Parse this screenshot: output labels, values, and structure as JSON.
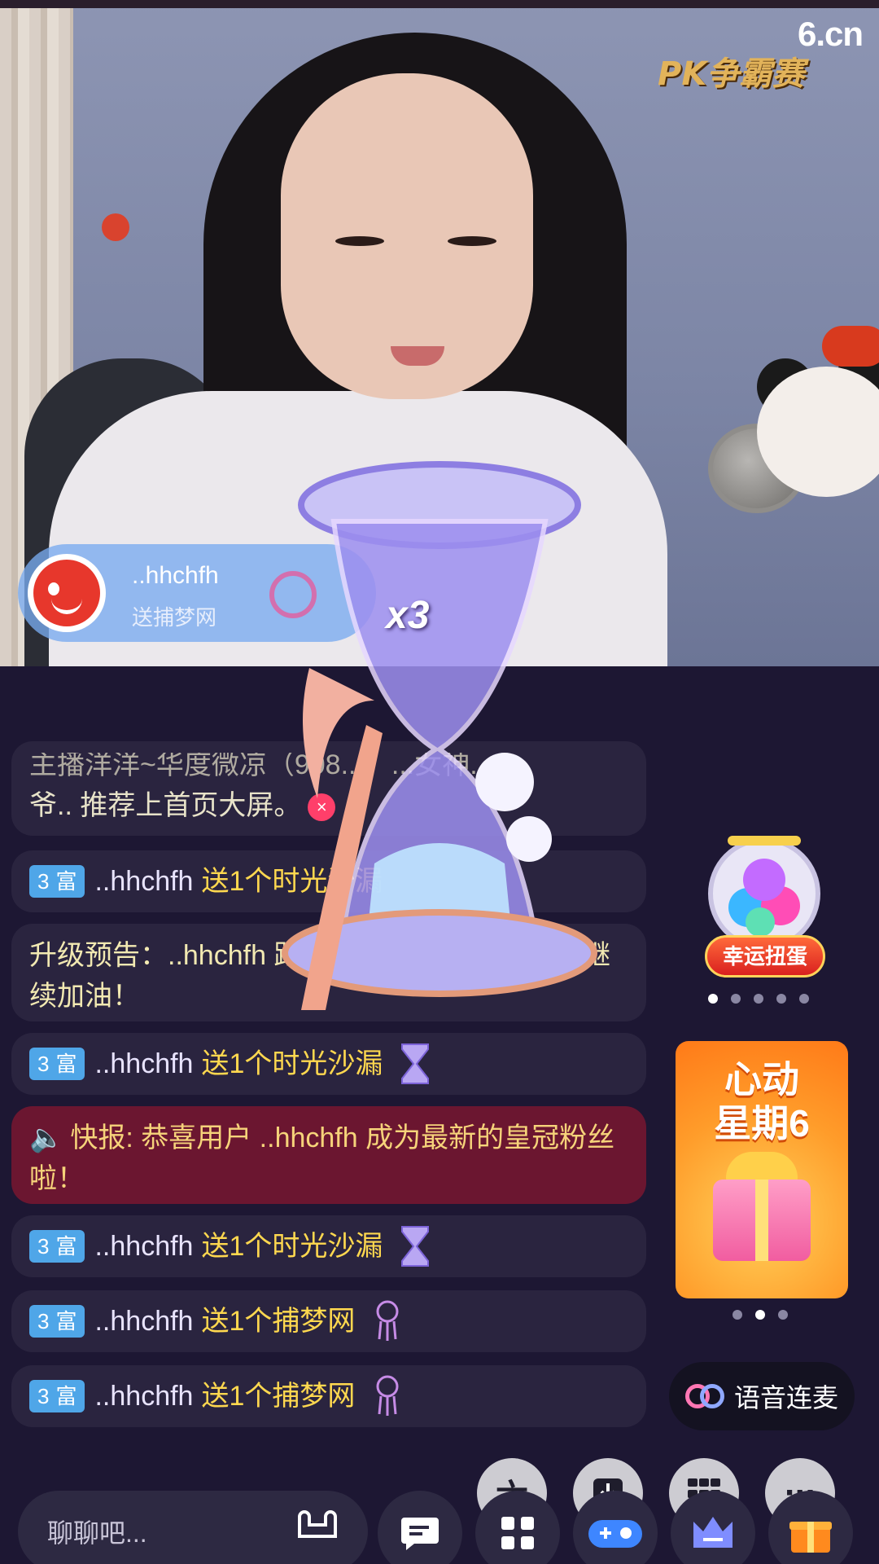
{
  "branding": {
    "site_logo": "6.cn",
    "pk_badge": "PK争霸赛"
  },
  "gift_notice": {
    "user": "..hhchfh",
    "action": "送捕梦网",
    "multiplier": "x3"
  },
  "chat": {
    "partial_top": "主播洋洋~华度微凉（908...）...女神...",
    "recommend_msg": "爷.. 推荐上首页大屏。",
    "messages": [
      {
        "level": "3",
        "level_label": "富",
        "user": "..hhchfh",
        "text": "送1个时光沙漏"
      },
      {
        "upgrade": "升级预告：..hhchfh 距 4 富 还差 ...345六币，继续加油！"
      },
      {
        "level": "3",
        "level_label": "富",
        "user": "..hhchfh",
        "text": "送1个时光沙漏"
      },
      {
        "alert": "快报: 恭喜用户 ..hhchfh 成为最新的皇冠粉丝啦！"
      },
      {
        "level": "3",
        "level_label": "富",
        "user": "..hhchfh",
        "text": "送1个时光沙漏"
      },
      {
        "level": "3",
        "level_label": "富",
        "user": "..hhchfh",
        "text": "送1个捕梦网"
      },
      {
        "level": "3",
        "level_label": "富",
        "user": "..hhchfh",
        "text": "送1个捕梦网"
      }
    ]
  },
  "widgets": {
    "gacha_label": "幸运扭蛋",
    "banner_title_1": "心动",
    "banner_title_2": "星期6",
    "voice_link": "语音连麦"
  },
  "fabs": {
    "six": "六",
    "more": "···"
  },
  "bottom_bar": {
    "chat_placeholder": "聊聊吧..."
  },
  "colors": {
    "bg": "#1d1733",
    "gift_text": "#ffd84f",
    "level_badge": "#4fa6e8",
    "alert_bg": "#6b1630"
  }
}
